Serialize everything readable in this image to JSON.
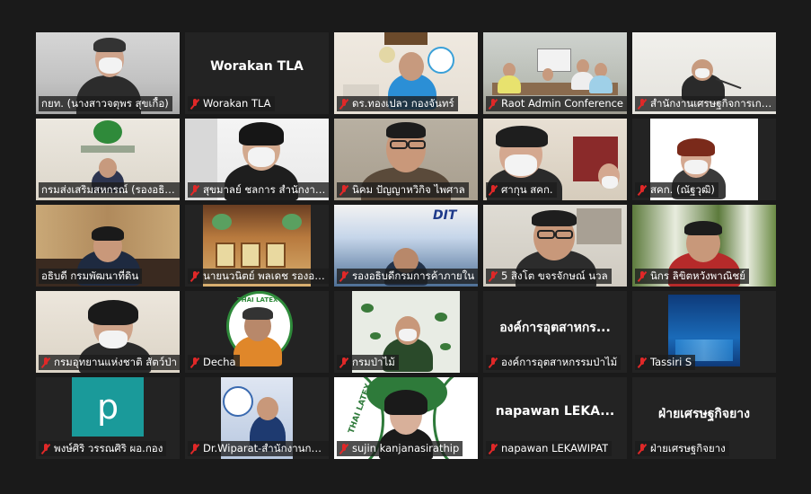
{
  "participants": [
    {
      "label": "กยท. (นางสาวจตุพร สุขเกื้อ)",
      "muted": false,
      "active": true
    },
    {
      "label": "Worakan TLA",
      "display_name": "Worakan TLA",
      "muted": true
    },
    {
      "label": "ดร.ทองเปลว กองจันทร์",
      "muted": true
    },
    {
      "label": "Raot Admin Conference",
      "muted": true
    },
    {
      "label": "สำนักงานเศรษฐกิจการเกษตร",
      "muted": true
    },
    {
      "label": "กรมส่งเสริมสหกรณ์ (รองอธิบดี)",
      "muted": false
    },
    {
      "label": "สุขมาลย์ ชลการ สำนักงานฯ",
      "muted": true
    },
    {
      "label": "นิคม ปัญญาหวิกิจ ไพศาล",
      "muted": true
    },
    {
      "label": "ศากุน สคก.",
      "muted": true
    },
    {
      "label": "สคก. (ณัฐวุฒิ)",
      "muted": true
    },
    {
      "label": "อธิบดี กรมพัฒนาที่ดิน",
      "muted": false
    },
    {
      "label": "นายนวนิตย์ พลเดช รองอธิบดี",
      "muted": true
    },
    {
      "label": "รองอธิบดีกรมการค้าภายใน",
      "muted": true
    },
    {
      "label": "5 สิงโต ขจรจักษณ์ นวล",
      "muted": true
    },
    {
      "label": "นิกร ลิขิตหวังพาณิชย์",
      "muted": true
    },
    {
      "label": "กรมอุทยานแห่งชาติ สัตว์ป่า",
      "muted": true
    },
    {
      "label": "Decha",
      "muted": true
    },
    {
      "label": "กรมป่าไม้",
      "muted": true
    },
    {
      "label": "องค์การอุตสาหกรรมป่าไม้",
      "display_name": "องค์การอุตสาหกร...",
      "muted": true
    },
    {
      "label": "Tassiri S",
      "muted": true
    },
    {
      "label": "พงษ์ศิริ วรรณศิริ ผอ.กอง",
      "muted": true
    },
    {
      "label": "Dr.Wiparat-สำนักงานการยาง",
      "muted": true
    },
    {
      "label": "sujin kanjanasirathip",
      "muted": true
    },
    {
      "label": "napawan LEKAWIPAT",
      "display_name": "napawan  LEKA...",
      "muted": true
    },
    {
      "label": "ฝ่ายเศรษฐกิจยาง",
      "display_name": "ฝ่ายเศรษฐกิจยาง",
      "muted": true
    }
  ],
  "avatar_letter": "p",
  "banner_text": "DIT",
  "logo_text": "THAI LATEX",
  "colors": {
    "background": "#1a1a1a",
    "tile": "#232323",
    "active_border": "#b4df2e",
    "muted_icon": "#e02828"
  }
}
